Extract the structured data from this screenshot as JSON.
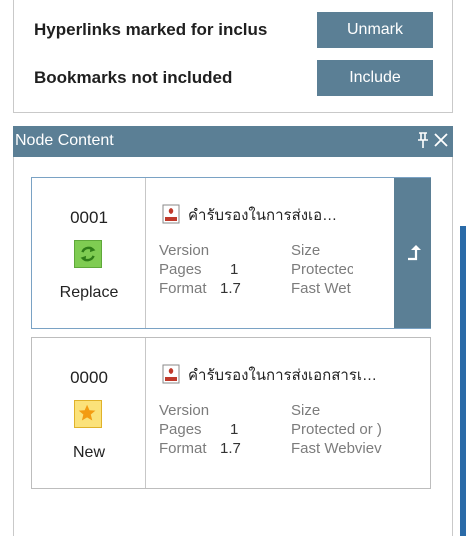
{
  "bookmarks": {
    "hyperlinks_label": "Hyperlinks marked for inclus",
    "unmark_label": "Unmark",
    "bookmarks_label": "Bookmarks not included",
    "include_label": "Include"
  },
  "node_content": {
    "title": "Node Content",
    "pin_icon": "pin-icon",
    "close_icon": "close-icon"
  },
  "cards": [
    {
      "number": "0001",
      "status": "Replace",
      "status_icon": "refresh-icon",
      "status_color": "#6cbf3f",
      "doc_title": "คำรับรองในการส่งเอ…",
      "version_label": "Version",
      "size_label": "Size",
      "pages_label": "Pages",
      "pages_value": "1",
      "protected_label": "Protectec",
      "format_label": "Format",
      "format_value": "1.7",
      "fastweb_label": "Fast Wet",
      "selected": true
    },
    {
      "number": "0000",
      "status": "New",
      "status_icon": "star-icon",
      "status_color": "#f5c518",
      "doc_title": "คำรับรองในการส่งเอกสารเ…",
      "version_label": "Version",
      "size_label": "Size",
      "pages_label": "Pages",
      "pages_value": "1",
      "protected_label": "Protected or )",
      "format_label": "Format",
      "format_value": "1.7",
      "fastweb_label": "Fast Webviev",
      "selected": false
    }
  ],
  "colors": {
    "accent": "#5b7f95",
    "selected_border": "#7aa2c4",
    "blue_strip": "#2a6ba8"
  }
}
